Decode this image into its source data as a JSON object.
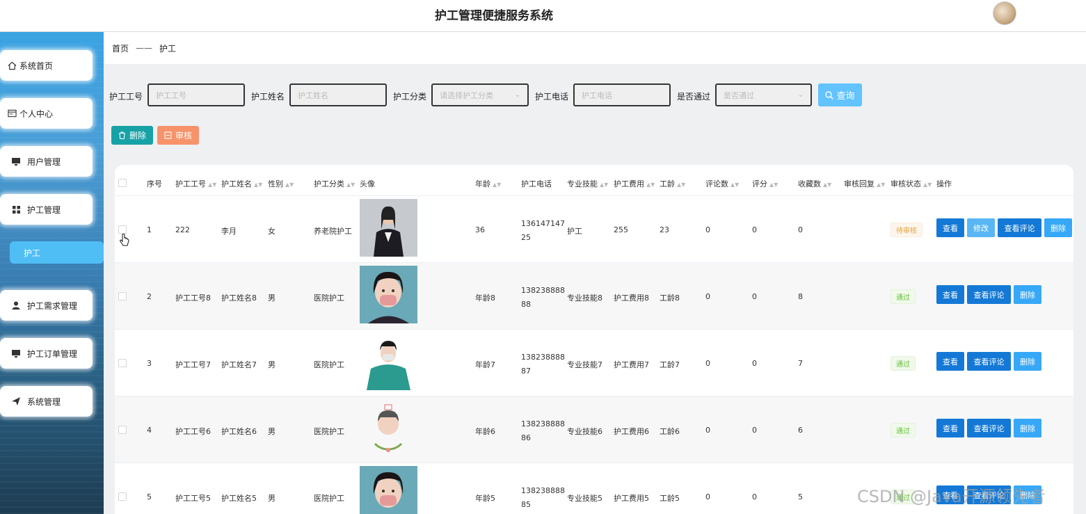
{
  "header": {
    "title": "护工管理便捷服务系统"
  },
  "sidebar": {
    "items": [
      {
        "label": "系统首页",
        "icon": "home-icon"
      },
      {
        "label": "个人中心",
        "icon": "id-card-icon"
      },
      {
        "label": "用户管理",
        "icon": "monitor-icon"
      },
      {
        "label": "护工管理",
        "icon": "grid-icon"
      },
      {
        "label": "护工",
        "icon": ""
      },
      {
        "label": "护工需求管理",
        "icon": "user-icon"
      },
      {
        "label": "护工订单管理",
        "icon": "monitor-icon"
      },
      {
        "label": "系统管理",
        "icon": "send-icon"
      }
    ]
  },
  "breadcrumb": {
    "home": "首页",
    "sep": "——",
    "current": "护工"
  },
  "search": {
    "f1_label": "护工工号",
    "f1_placeholder": "护工工号",
    "f2_label": "护工姓名",
    "f2_placeholder": "护工姓名",
    "f3_label": "护工分类",
    "f3_placeholder": "请选择护工分类",
    "f4_label": "护工电话",
    "f4_placeholder": "护工电话",
    "f5_label": "是否通过",
    "f5_placeholder": "是否通过",
    "query": "查询"
  },
  "toolbar": {
    "delete": "删除",
    "audit": "审核"
  },
  "table": {
    "columns": [
      "序号",
      "护工工号",
      "护工姓名",
      "性别",
      "护工分类",
      "头像",
      "年龄",
      "护工电话",
      "专业技能",
      "护工费用",
      "工龄",
      "评论数",
      "评分",
      "收藏数",
      "审核回复",
      "审核状态",
      "操作"
    ],
    "rows": [
      {
        "idx": "1",
        "no": "222",
        "name": "李月",
        "sex": "女",
        "cat": "养老院护工",
        "age": "36",
        "tel1": "136147147",
        "tel2": "25",
        "skill": "护工",
        "fee": "255",
        "years": "23",
        "comments": "0",
        "score": "0",
        "fav": "0",
        "status": "待审核"
      },
      {
        "idx": "2",
        "no": "护工工号8",
        "name": "护工姓名8",
        "sex": "男",
        "cat": "医院护工",
        "age": "年龄8",
        "tel1": "138238888",
        "tel2": "88",
        "skill": "专业技能8",
        "fee": "护工费用8",
        "years": "工龄8",
        "comments": "0",
        "score": "0",
        "fav": "8",
        "status": "通过"
      },
      {
        "idx": "3",
        "no": "护工工号7",
        "name": "护工姓名7",
        "sex": "男",
        "cat": "医院护工",
        "age": "年龄7",
        "tel1": "138238888",
        "tel2": "87",
        "skill": "专业技能7",
        "fee": "护工费用7",
        "years": "工龄7",
        "comments": "0",
        "score": "0",
        "fav": "7",
        "status": "通过"
      },
      {
        "idx": "4",
        "no": "护工工号6",
        "name": "护工姓名6",
        "sex": "男",
        "cat": "医院护工",
        "age": "年龄6",
        "tel1": "138238888",
        "tel2": "86",
        "skill": "专业技能6",
        "fee": "护工费用6",
        "years": "工龄6",
        "comments": "0",
        "score": "0",
        "fav": "6",
        "status": "通过"
      },
      {
        "idx": "5",
        "no": "护工工号5",
        "name": "护工姓名5",
        "sex": "男",
        "cat": "医院护工",
        "age": "年龄5",
        "tel1": "138238888",
        "tel2": "85",
        "skill": "专业技能5",
        "fee": "护工费用5",
        "years": "工龄5",
        "comments": "0",
        "score": "0",
        "fav": "5",
        "status": "通过"
      }
    ],
    "actions": {
      "view": "查看",
      "edit": "修改",
      "comments": "查看评论",
      "delete": "删除"
    }
  },
  "watermark": "CSDN @Java开源领先者"
}
